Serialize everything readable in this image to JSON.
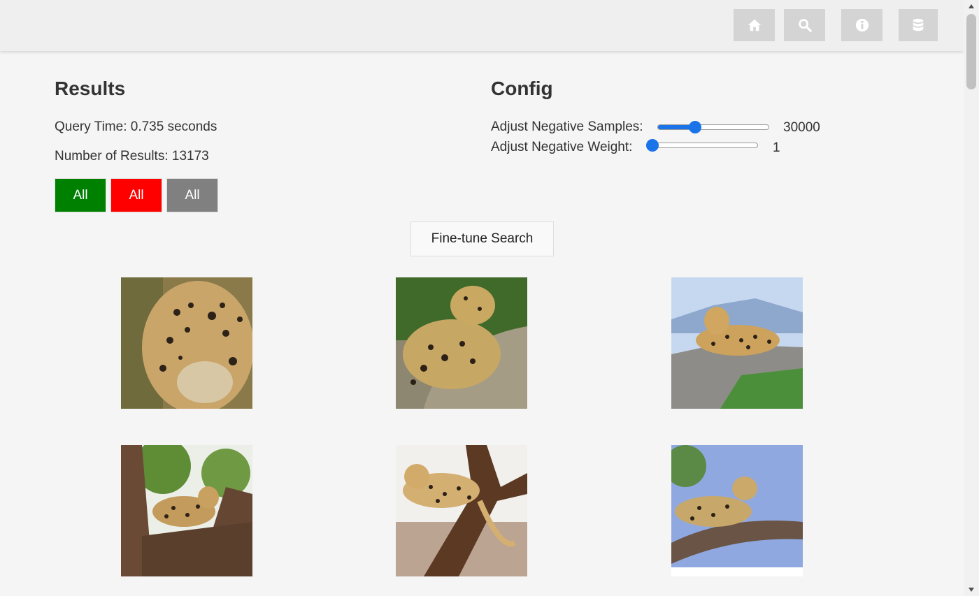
{
  "nav": {
    "items": [
      {
        "icon": "home-icon"
      },
      {
        "icon": "search-icon"
      },
      {
        "icon": "info-icon"
      },
      {
        "icon": "database-icon"
      }
    ]
  },
  "results": {
    "title": "Results",
    "query_time": "Query Time: 0.735 seconds",
    "num_results": "Number of Results: 13173",
    "filters": [
      {
        "label": "All",
        "color": "#008000"
      },
      {
        "label": "All",
        "color": "#ff0000"
      },
      {
        "label": "All",
        "color": "#808080"
      }
    ]
  },
  "config": {
    "title": "Config",
    "samples_label": "Adjust Negative Samples:",
    "samples_value": "30000",
    "samples_fraction": 0.32,
    "weight_label": "Adjust Negative Weight:",
    "weight_value": "1",
    "weight_fraction": 0.0
  },
  "finetune_label": "Fine-tune Search",
  "images": [
    {
      "alt": "leopard crouching in grass"
    },
    {
      "alt": "leopard resting on log"
    },
    {
      "alt": "leopard lying on rock"
    },
    {
      "alt": "leopard in tree"
    },
    {
      "alt": "leopard on branch"
    },
    {
      "alt": "leopard on branch stock photo"
    }
  ],
  "colors": {
    "accent": "#1a73e8",
    "background": "#f5f5f5"
  }
}
